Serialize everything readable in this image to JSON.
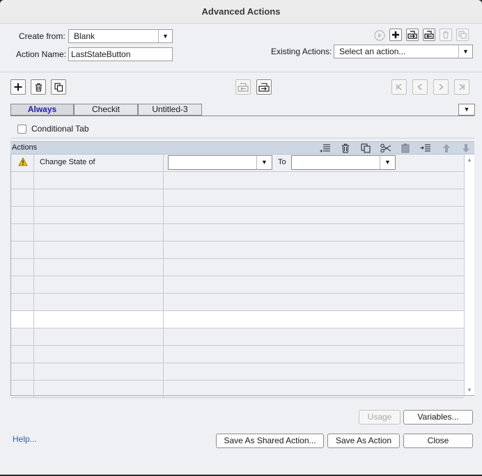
{
  "window": {
    "title": "Advanced Actions"
  },
  "form": {
    "create_from_label": "Create from:",
    "create_from_value": "Blank",
    "action_name_label": "Action Name:",
    "action_name_value": "LastStateButton",
    "existing_actions_label": "Existing Actions:",
    "existing_actions_value": "Select an action..."
  },
  "tabs": [
    {
      "label": "Always",
      "active": true
    },
    {
      "label": "Checkit",
      "active": false
    },
    {
      "label": "Untitled-3",
      "active": false
    }
  ],
  "conditional_tab_label": "Conditional Tab",
  "conditional_tab_checked": false,
  "actions_section": {
    "header_label": "Actions",
    "first_row": {
      "action": "Change State of",
      "target_value": "",
      "to_label": "To",
      "to_value": ""
    },
    "empty_row_count": 13,
    "highlighted_row_index": 8
  },
  "buttons": {
    "usage": "Usage",
    "variables": "Variables...",
    "help": "Help...",
    "save_shared": "Save As Shared Action...",
    "save_action": "Save As Action",
    "close": "Close"
  },
  "colors": {
    "accent_tab_text": "#2020b0",
    "help_link": "#2d5fb0",
    "warning_icon": "#f2c200"
  }
}
